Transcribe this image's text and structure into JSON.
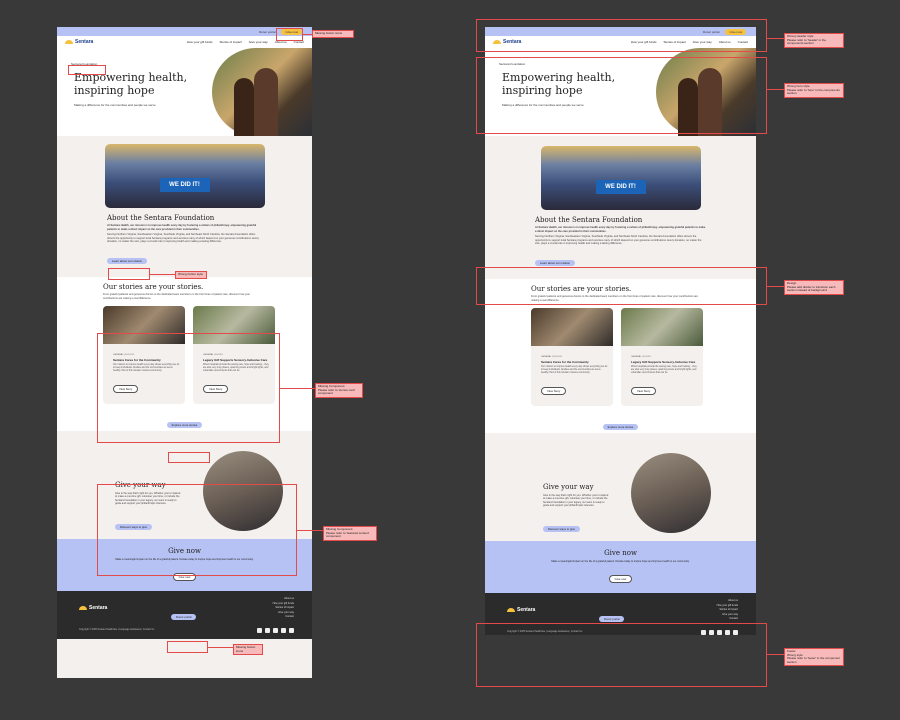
{
  "pages": [
    {
      "id": "left",
      "topbar": {
        "link1": "Donor portal",
        "donate": "Give now"
      },
      "nav": {
        "logo": "Sentara",
        "links": [
          "How your gift funds",
          "Stories of impact",
          "Give your way",
          "About us",
          "Contact"
        ]
      },
      "hero": {
        "crumb": "Sentara Foundation",
        "title": "Empowering health, inspiring hope",
        "subtitle": "Making a difference for the communities and people we serve"
      },
      "about": {
        "banner": "WE DID IT!",
        "title": "About the Sentara Foundation",
        "para1": "At Sentara Health, our mission is to improve health every day by fostering a culture of philanthropy, empowering grateful patients to make a direct impact on the care provided in their communities.",
        "para2": "Serving Northern Virginia, Southeastern Virginia, Southside Virginia, and Northeast North Carolina, the Sentara Foundation offers donors the opportunity to support local Sentara programs and services many of which depend on your generous contributions. Every donation, no matter the size, plays a crucial role in improving health and making a lasting difference.",
        "button": "Learn about our mission"
      },
      "stories": {
        "title": "Our stories are your stories.",
        "intro": "From grateful patients and generous donors to the dedicated team members on the front lines of patient care, discover how your contributions are making a real difference.",
        "cards": [
          {
            "cat": "GENERAL | 10.14.24",
            "title": "Sentara Cares for the Community",
            "desc": "Our mission to improve health every day shows everything we do to keep individuals, families and the communities we serve healthy. Part of this mission involves community.",
            "button": "View Story"
          },
          {
            "cat": "GENERAL | 10.9.24",
            "title": "Legacy Gift Supports Sensory-Inclusive Care",
            "desc": "When hospitals provide life-saving care, hope and healing – they are also very busy places, spanning stress and bright lights, and unfamiliar environments that can be.",
            "button": "View Story"
          }
        ],
        "button": "Explore more stories"
      },
      "give": {
        "title": "Give your way",
        "desc": "Give in the way that's right for you. Whether you're inspired to make a one-time gift, volunteer your time, or include the Sentara Foundation in your legacy, our team is ready to guide and support your philanthropic interests.",
        "button": "Discover ways to give"
      },
      "givenow": {
        "title": "Give now",
        "desc": "Make a meaningful impact on the life of a grateful patient. Donate today to inspire hope and improve health in our community.",
        "button": "Give now"
      },
      "footer": {
        "logo": "Sentara",
        "portal": "Donor portal",
        "links": [
          "About us",
          "How your gift funds",
          "Stories of impact",
          "Give your way",
          "Contact"
        ],
        "copy": "Copyright © 2025 Sentara Healthcare | Language Assistance | Contact Us"
      }
    },
    {
      "id": "right",
      "topbar": {
        "link1": "Donor portal",
        "donate": "Give now"
      },
      "nav": {
        "logo": "Sentara",
        "links": [
          "How your gift funds",
          "Stories of impact",
          "Give your way",
          "About us",
          "Contact"
        ]
      },
      "hero": {
        "crumb": "Sentara Foundation",
        "title": "Empowering health, inspiring hope",
        "subtitle": "Making a difference for the communities and people we serve"
      },
      "about": {
        "banner": "WE DID IT!",
        "title": "About the Sentara Foundation",
        "para1": "At Sentara Health, our mission is to improve health every day by fostering a culture of philanthropy, empowering grateful patients to make a direct impact on the care provided in their communities.",
        "para2": "Serving Northern Virginia, Southeastern Virginia, Southside Virginia, and Northeast North Carolina, the Sentara Foundation offers donors the opportunity to support local Sentara programs and services many of which depend on your generous contributions. Every donation, no matter the size, plays a crucial role in improving health and making a lasting difference.",
        "button": "Learn about our mission"
      },
      "stories": {
        "title": "Our stories are your stories.",
        "intro": "From grateful patients and generous donors to the dedicated team members on the front lines of patient care, discover how your contributions are making a real difference.",
        "cards": [
          {
            "cat": "GENERAL | 10.14.24",
            "title": "Sentara Cares for the Community",
            "desc": "Our mission to improve health every day shows everything we do to keep individuals, families and the communities we serve healthy. Part of this mission involves community.",
            "button": "View Story"
          },
          {
            "cat": "GENERAL | 10.9.24",
            "title": "Legacy Gift Supports Sensory-Inclusive Care",
            "desc": "When hospitals provide life-saving care, hope and healing – they are also very busy places, spanning stress and bright lights, and unfamiliar environments that can be.",
            "button": "View Story"
          }
        ],
        "button": "Explore more stories"
      },
      "give": {
        "title": "Give your way",
        "desc": "Give in the way that's right for you. Whether you're inspired to make a one-time gift, volunteer your time, or include the Sentara Foundation in your legacy, our team is ready to guide and support your philanthropic interests.",
        "button": "Discover ways to give"
      },
      "givenow": {
        "title": "Give now",
        "desc": "Make a meaningful impact on the life of a grateful patient. Donate today to inspire hope and improve health in our community.",
        "button": "Give now"
      },
      "footer": {
        "logo": "Sentara",
        "portal": "Donor portal",
        "links": [
          "About us",
          "How your gift funds",
          "Stories of impact",
          "Give your way",
          "Contact"
        ],
        "copy": "Copyright © 2025 Sentara Healthcare | Language Assistance | Contact Us"
      }
    }
  ],
  "annotations_left": [
    {
      "text": "Missing button icons"
    },
    {
      "text": "Wrong button style"
    },
    {
      "text": "Missing Component\nPlease refer to 'stories card' component"
    },
    {
      "text": "Missing Component\nPlease refer to 'featured content' component"
    },
    {
      "text": "Missing button icons"
    }
  ],
  "annotations_right": [
    {
      "text": "Wrong Header style\nPlease refer to 'header' in the components section"
    },
    {
      "text": "Wrong hero style\nPlease refer to 'hero' in the components section"
    },
    {
      "text": "Design\nPlease add divider to transition each section instead of background"
    },
    {
      "text": "Footer\nWrong style\nPlease refer to 'footer' in the component section"
    }
  ],
  "colors": {
    "accent": "#b7c2f4",
    "donate": "#f6c23e",
    "annotation": "#e34b4b",
    "note_bg": "#f7b9b9",
    "footer": "#2b2b2b"
  }
}
